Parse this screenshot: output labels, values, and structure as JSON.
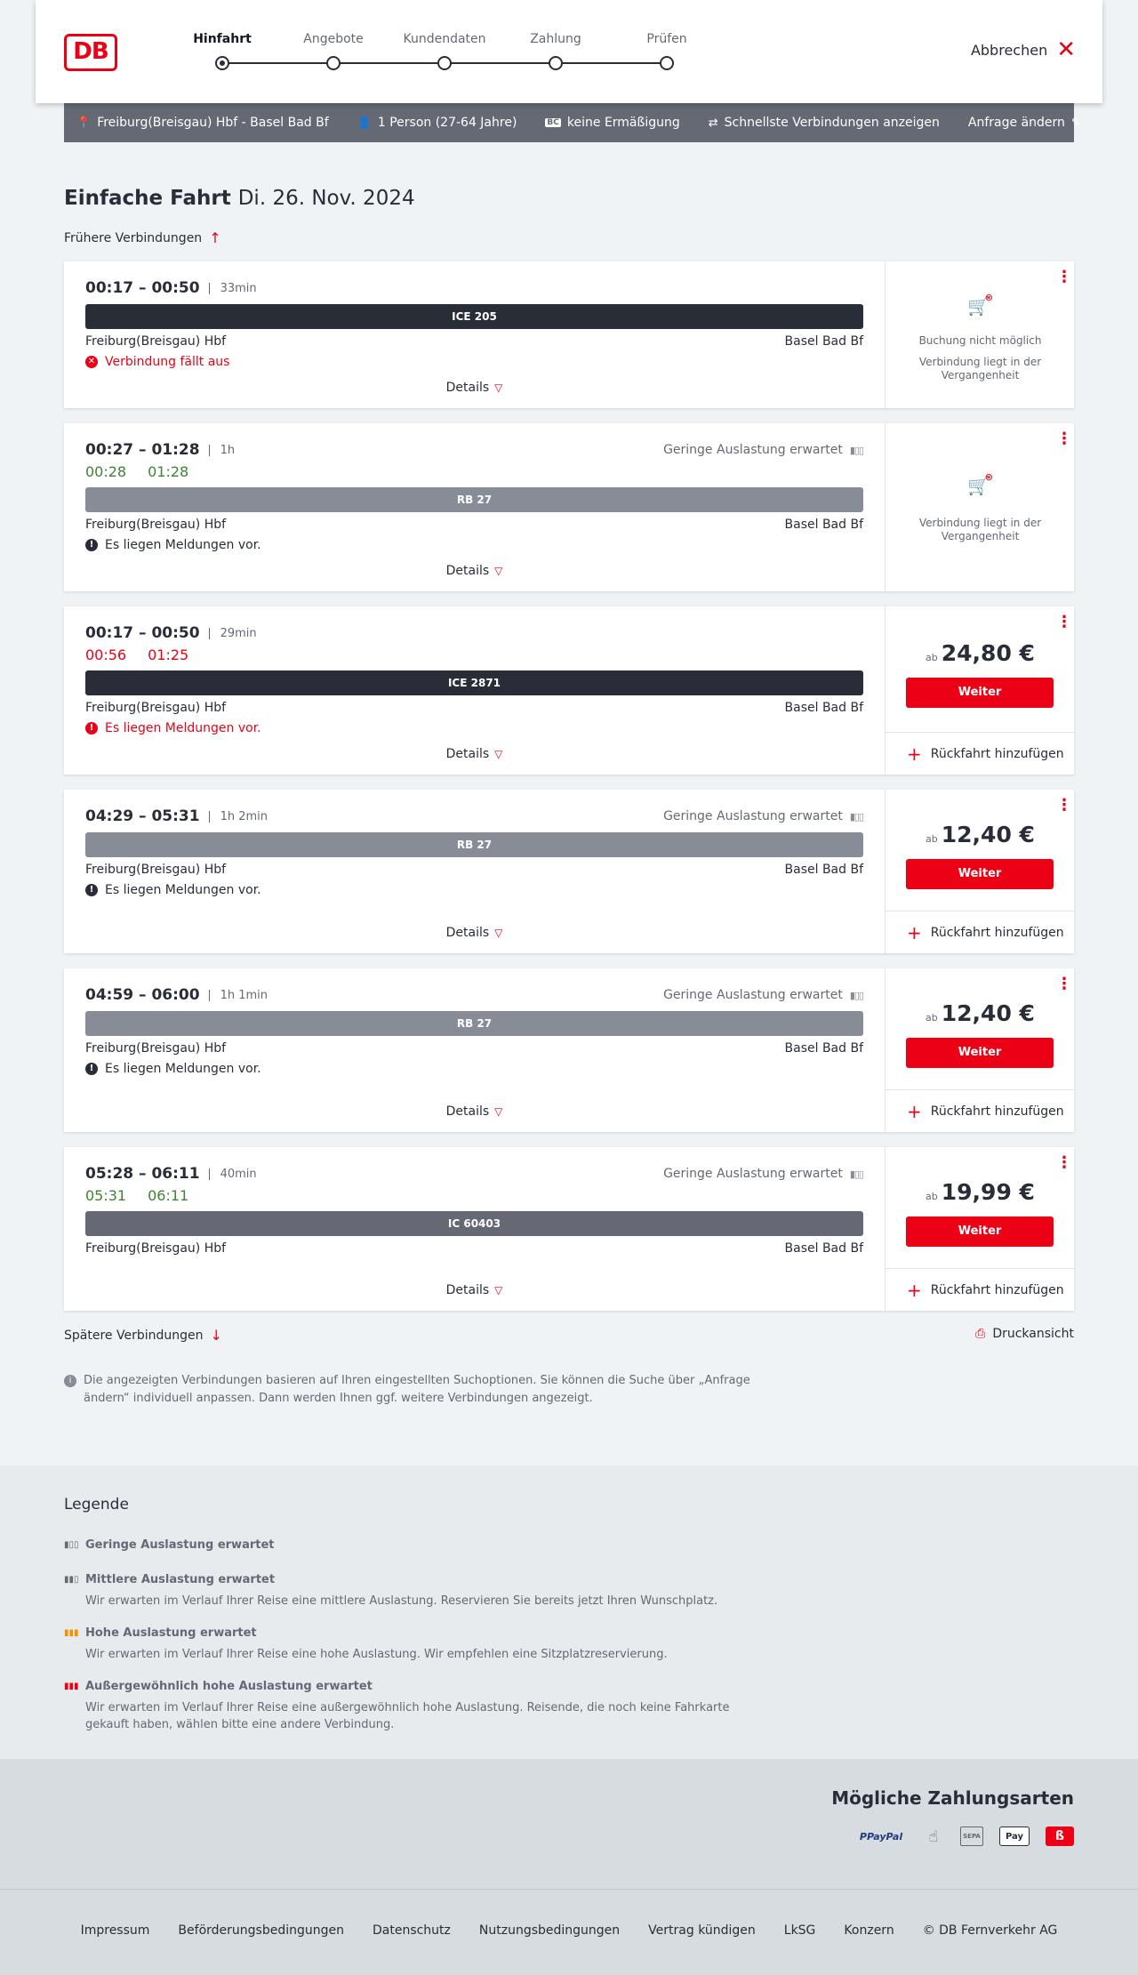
{
  "header": {
    "logo": "DB",
    "steps": [
      "Hinfahrt",
      "Angebote",
      "Kundendaten",
      "Zahlung",
      "Prüfen"
    ],
    "cancel_label": "Abbrechen"
  },
  "summary": {
    "route": "Freiburg(Breisgau) Hbf - Basel Bad Bf",
    "persons": "1 Person (27-64 Jahre)",
    "discount": "keine Ermäßigung",
    "fastest": "Schnellste Verbindungen anzeigen",
    "change": "Anfrage ändern"
  },
  "title": {
    "type": "Einfache Fahrt",
    "date": "Di. 26. Nov. 2024"
  },
  "earlier_label": "Frühere Verbindungen",
  "later_label": "Spätere Verbindungen",
  "print_label": "Druckansicht",
  "details_label": "Details",
  "return_label": "Rückfahrt hinzufügen",
  "weiter_label": "Weiter",
  "price_prefix": "ab",
  "connections": [
    {
      "times": "00:17 – 00:50",
      "duration": "33min",
      "train": "ICE 205",
      "from": "Freiburg(Breisgau) Hbf",
      "to": "Basel Bad Bf",
      "message": "Verbindung fällt aus",
      "na_title": "Buchung nicht möglich",
      "na_text": "Verbindung liegt in der Vergangenheit"
    },
    {
      "times": "00:27 – 01:28",
      "duration": "1h",
      "rt_dep": "00:28",
      "rt_arr": "01:28",
      "load": "Geringe Auslastung erwartet",
      "train": "RB 27",
      "from": "Freiburg(Breisgau) Hbf",
      "to": "Basel Bad Bf",
      "message": "Es liegen Meldungen vor.",
      "na_text": "Verbindung liegt in der Vergangenheit"
    },
    {
      "times": "00:17 – 00:50",
      "duration": "29min",
      "rt_dep": "00:56",
      "rt_arr": "01:25",
      "train": "ICE 2871",
      "from": "Freiburg(Breisgau) Hbf",
      "to": "Basel Bad Bf",
      "message": "Es liegen Meldungen vor.",
      "price": "24,80 €"
    },
    {
      "times": "04:29 – 05:31",
      "duration": "1h 2min",
      "load": "Geringe Auslastung erwartet",
      "train": "RB 27",
      "from": "Freiburg(Breisgau) Hbf",
      "to": "Basel Bad Bf",
      "message": "Es liegen Meldungen vor.",
      "price": "12,40 €"
    },
    {
      "times": "04:59 – 06:00",
      "duration": "1h 1min",
      "load": "Geringe Auslastung erwartet",
      "train": "RB 27",
      "from": "Freiburg(Breisgau) Hbf",
      "to": "Basel Bad Bf",
      "message": "Es liegen Meldungen vor.",
      "price": "12,40 €"
    },
    {
      "times": "05:28 – 06:11",
      "duration": "40min",
      "rt_dep": "05:31",
      "rt_arr": "06:11",
      "load": "Geringe Auslastung erwartet",
      "train": "IC 60403",
      "from": "Freiburg(Breisgau) Hbf",
      "to": "Basel Bad Bf",
      "price": "19,99 €"
    }
  ],
  "info_text": "Die angezeigten Verbindungen basieren auf Ihren eingestellten Suchoptionen. Sie können die Suche über „Anfrage ändern“ individuell anpassen. Dann werden Ihnen ggf. weitere Verbindungen angezeigt.",
  "legend": {
    "title": "Legende",
    "items": [
      {
        "title": "Geringe Auslastung erwartet",
        "text": ""
      },
      {
        "title": "Mittlere Auslastung erwartet",
        "text": "Wir erwarten im Verlauf Ihrer Reise eine mittlere Auslastung. Reservieren Sie bereits jetzt Ihren Wunschplatz."
      },
      {
        "title": "Hohe Auslastung erwartet",
        "text": "Wir erwarten im Verlauf Ihrer Reise eine hohe Auslastung. Wir empfehlen eine Sitzplatzreservierung."
      },
      {
        "title": "Außergewöhnlich hohe Auslastung erwartet",
        "text": "Wir erwarten im Verlauf Ihrer Reise eine außergewöhnlich hohe Auslastung. Reisende, die noch keine Fahrkarte gekauft haben, wählen bitte eine andere Verbindung."
      }
    ]
  },
  "payments": {
    "title": "Mögliche Zahlungsarten",
    "paypal": "PayPal",
    "sepa": "SEPA",
    "applepay": "Pay"
  },
  "footer": [
    "Impressum",
    "Beförderungsbedingungen",
    "Datenschutz",
    "Nutzungsbedingungen",
    "Vertrag kündigen",
    "LkSG",
    "Konzern",
    "© DB Fernverkehr AG"
  ],
  "colors": {
    "brand": "#ec0016",
    "delay_green": "#408335",
    "text": "#282d37"
  }
}
